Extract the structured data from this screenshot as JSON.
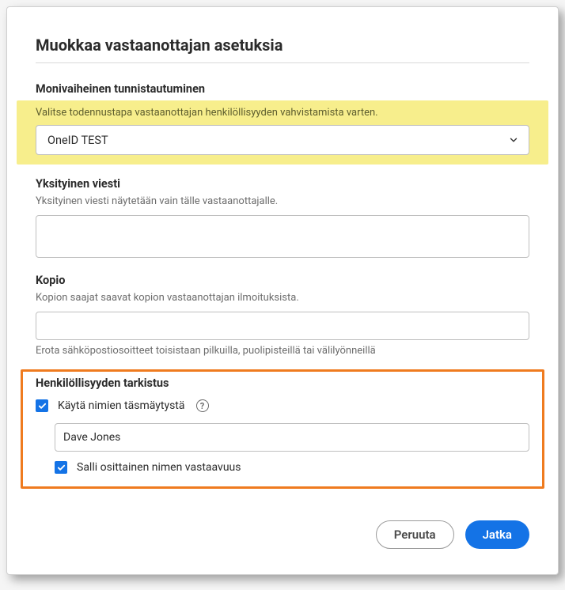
{
  "dialog": {
    "title": "Muokkaa vastaanottajan asetuksia"
  },
  "mfa": {
    "label": "Monivaiheinen tunnistautuminen",
    "help": "Valitse todennustapa vastaanottajan henkilöllisyyden vahvistamista varten.",
    "selected": "OneID TEST"
  },
  "privateMessage": {
    "label": "Yksityinen viesti",
    "help": "Yksityinen viesti näytetään vain tälle vastaanottajalle.",
    "value": ""
  },
  "copy": {
    "label": "Kopio",
    "help": "Kopion saajat saavat kopion vastaanottajan ilmoituksista.",
    "value": "",
    "hint": "Erota sähköpostiosoitteet toisistaan pilkuilla, puolipisteillä tai välilyönneillä"
  },
  "identity": {
    "label": "Henkilöllisyyden tarkistus",
    "useNameMatchLabel": "Käytä nimien täsmäytystä",
    "nameValue": "Dave Jones",
    "allowPartialLabel": "Salli osittainen nimen vastaavuus"
  },
  "footer": {
    "cancel": "Peruuta",
    "continue": "Jatka"
  }
}
